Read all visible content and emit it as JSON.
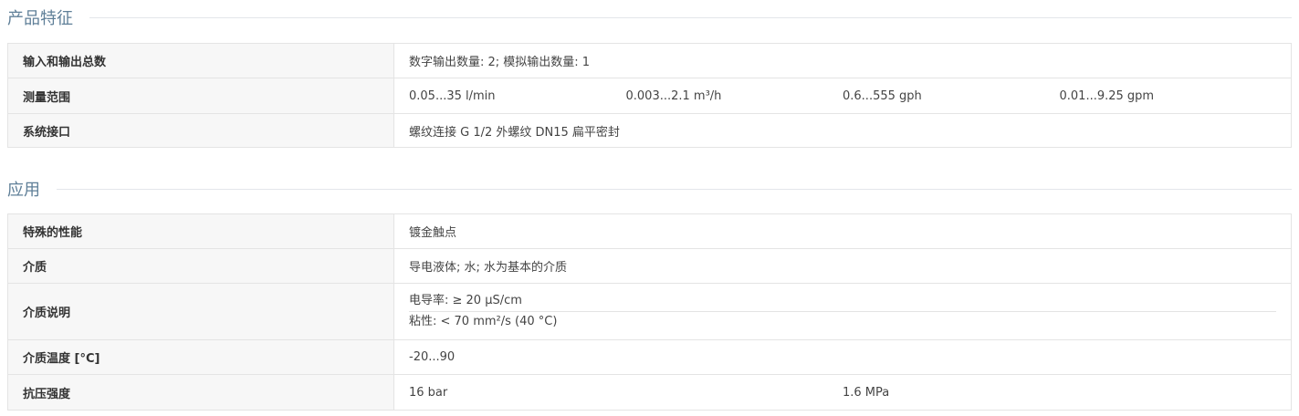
{
  "features": {
    "title": "产品特征",
    "rows": [
      {
        "label": "输入和输出总数",
        "value": "数字输出数量: 2; 模拟输出数量: 1"
      },
      {
        "label": "测量范围",
        "values": [
          "0.05...35 l/min",
          "0.003...2.1 m³/h",
          "0.6...555 gph",
          "0.01...9.25 gpm"
        ]
      },
      {
        "label": "系统接口",
        "value": "螺纹连接 G 1/2 外螺纹 DN15 扁平密封"
      }
    ]
  },
  "application": {
    "title": "应用",
    "rows": [
      {
        "label": "特殊的性能",
        "value": "镀金触点"
      },
      {
        "label": "介质",
        "value": "导电液体; 水; 水为基本的介质"
      },
      {
        "label": "介质说明",
        "lines": [
          "电导率: ≥ 20 µS/cm",
          "粘性: < 70 mm²/s (40 °C)"
        ]
      },
      {
        "label": "介质温度 [°C]",
        "value": "-20...90"
      },
      {
        "label": "抗压强度",
        "values": [
          "16 bar",
          "1.6 MPa"
        ]
      }
    ]
  }
}
